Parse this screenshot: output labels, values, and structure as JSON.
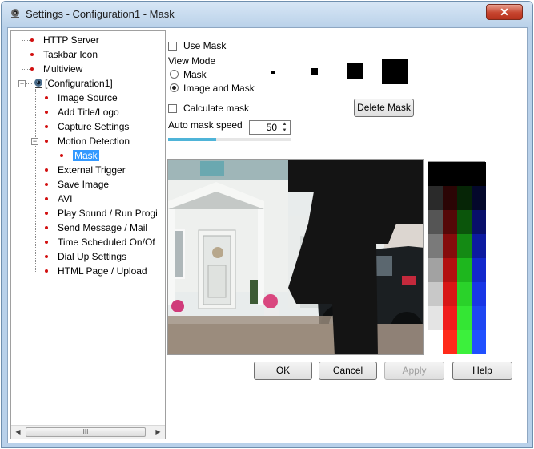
{
  "window": {
    "title": "Settings - Configuration1 - Mask"
  },
  "tree": {
    "items": [
      {
        "label": "HTTP Server",
        "level": 1
      },
      {
        "label": "Taskbar Icon",
        "level": 1
      },
      {
        "label": "Multiview",
        "level": 1
      },
      {
        "label": "[Configuration1]",
        "level": 1,
        "expander": "minus",
        "icon": "camera-icon"
      },
      {
        "label": "Image Source",
        "level": 2
      },
      {
        "label": "Add Title/Logo",
        "level": 2
      },
      {
        "label": "Capture Settings",
        "level": 2
      },
      {
        "label": "Motion Detection",
        "level": 2,
        "expander": "minus"
      },
      {
        "label": "Mask",
        "level": 3,
        "selected": true
      },
      {
        "label": "External Trigger",
        "level": 2
      },
      {
        "label": "Save Image",
        "level": 2
      },
      {
        "label": "AVI",
        "level": 2
      },
      {
        "label": "Play Sound / Run Progi",
        "level": 2
      },
      {
        "label": "Send Message / Mail",
        "level": 2
      },
      {
        "label": "Time Scheduled On/Of",
        "level": 2
      },
      {
        "label": "Dial Up Settings",
        "level": 2
      },
      {
        "label": "HTML Page / Upload",
        "level": 2
      }
    ],
    "scroll_thumb": "III"
  },
  "mask": {
    "use_mask_label": "Use Mask",
    "view_mode_label": "View Mode",
    "mode_mask_label": "Mask",
    "mode_image_and_mask_label": "Image and Mask",
    "calculate_mask_label": "Calculate mask",
    "delete_mask_label": "Delete Mask",
    "auto_mask_speed_label": "Auto mask speed",
    "auto_mask_speed_value": "50",
    "auto_mask_speed_progress": 0.39,
    "selected_mode": "image_and_mask",
    "brush_sizes": [
      "tiny",
      "small",
      "medium",
      "large"
    ]
  },
  "buttons": {
    "ok": "OK",
    "cancel": "Cancel",
    "apply": "Apply",
    "help": "Help"
  },
  "colors": {
    "selection": "#3399ff",
    "tree_bullet": "#d21010",
    "progress_fill": "#4fb4d8"
  }
}
